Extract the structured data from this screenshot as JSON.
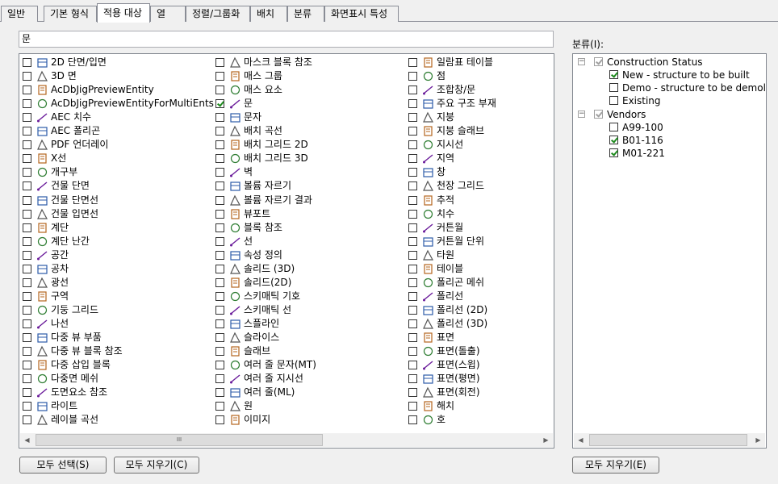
{
  "tabs": [
    "일반",
    "기본 형식",
    "적용 대상",
    "열",
    "정렬/그룹화",
    "배치",
    "분류",
    "화면표시 특성"
  ],
  "search": {
    "value": "문"
  },
  "object_list": {
    "columns": [
      [
        {
          "label": "2D 단면/입면",
          "icon": "section-elevation-icon",
          "checked": false
        },
        {
          "label": "3D 면",
          "icon": "3d-face-icon",
          "checked": false
        },
        {
          "label": "AcDbJigPreviewEntity",
          "icon": "generic-entity-icon",
          "checked": false
        },
        {
          "label": "AcDbJigPreviewEntityForMultiEnts",
          "icon": "generic-entity-icon",
          "checked": false
        },
        {
          "label": "AEC 치수",
          "icon": "aec-dimension-icon",
          "checked": false
        },
        {
          "label": "AEC 폴리곤",
          "icon": "aec-polygon-icon",
          "checked": false
        },
        {
          "label": "PDF 언더레이",
          "icon": "pdf-icon",
          "checked": false
        },
        {
          "label": "X선",
          "icon": "xline-icon",
          "checked": false
        },
        {
          "label": "개구부",
          "icon": "opening-icon",
          "checked": false
        },
        {
          "label": "건물 단면",
          "icon": "building-section-icon",
          "checked": false
        },
        {
          "label": "건물 단면선",
          "icon": "section-line-icon",
          "checked": false
        },
        {
          "label": "건물 입면선",
          "icon": "elevation-line-icon",
          "checked": false
        },
        {
          "label": "계단",
          "icon": "stair-icon",
          "checked": false
        },
        {
          "label": "계단 난간",
          "icon": "railing-icon",
          "checked": false
        },
        {
          "label": "공간",
          "icon": "space-icon",
          "checked": false
        },
        {
          "label": "공차",
          "icon": "tolerance-icon",
          "checked": false
        },
        {
          "label": "광선",
          "icon": "ray-icon",
          "checked": false
        },
        {
          "label": "구역",
          "icon": "zone-icon",
          "checked": false
        },
        {
          "label": "기둥 그리드",
          "icon": "column-grid-icon",
          "checked": false
        },
        {
          "label": "나선",
          "icon": "helix-icon",
          "checked": false
        },
        {
          "label": "다중 뷰 부품",
          "icon": "mvpart-icon",
          "checked": false
        },
        {
          "label": "다중 뷰 블록 참조",
          "icon": "mvblock-icon",
          "checked": false
        },
        {
          "label": "다중 삽입 블록",
          "icon": "minsert-icon",
          "checked": false
        },
        {
          "label": "다중면 메쉬",
          "icon": "polyface-mesh-icon",
          "checked": false
        },
        {
          "label": "도면요소 참조",
          "icon": "detail-ref-icon",
          "checked": false
        },
        {
          "label": "라이트",
          "icon": "light-icon",
          "checked": false
        },
        {
          "label": "레이블 곡선",
          "icon": "label-curve-icon",
          "checked": false
        }
      ],
      [
        {
          "label": "마스크 블록 참조",
          "icon": "mask-block-icon",
          "checked": false
        },
        {
          "label": "매스 그룹",
          "icon": "mass-group-icon",
          "checked": false
        },
        {
          "label": "매스 요소",
          "icon": "mass-element-icon",
          "checked": false
        },
        {
          "label": "문",
          "icon": "door-icon",
          "checked": true
        },
        {
          "label": "문자",
          "icon": "text-icon",
          "checked": false
        },
        {
          "label": "배치 곡선",
          "icon": "layout-curve-icon",
          "checked": false
        },
        {
          "label": "배치 그리드 2D",
          "icon": "layout-grid-2d-icon",
          "checked": false
        },
        {
          "label": "배치 그리드 3D",
          "icon": "layout-grid-3d-icon",
          "checked": false
        },
        {
          "label": "벽",
          "icon": "wall-icon",
          "checked": false
        },
        {
          "label": "볼륨 자르기",
          "icon": "slice-icon",
          "checked": false
        },
        {
          "label": "볼륨 자르기 결과",
          "icon": "slice-result-icon",
          "checked": false
        },
        {
          "label": "뷰포트",
          "icon": "viewport-icon",
          "checked": false
        },
        {
          "label": "블록 참조",
          "icon": "block-ref-icon",
          "checked": false
        },
        {
          "label": "선",
          "icon": "line-icon",
          "checked": false
        },
        {
          "label": "속성 정의",
          "icon": "attdef-icon",
          "checked": false
        },
        {
          "label": "솔리드 (3D)",
          "icon": "solid3d-icon",
          "checked": false
        },
        {
          "label": "솔리드(2D)",
          "icon": "solid2d-icon",
          "checked": false
        },
        {
          "label": "스키매틱 기호",
          "icon": "schematic-symbol-icon",
          "checked": false
        },
        {
          "label": "스키매틱 선",
          "icon": "schematic-line-icon",
          "checked": false
        },
        {
          "label": "스플라인",
          "icon": "spline-icon",
          "checked": false
        },
        {
          "label": "슬라이스",
          "icon": "slice2-icon",
          "checked": false
        },
        {
          "label": "슬래브",
          "icon": "slab-icon",
          "checked": false
        },
        {
          "label": "여러 줄 문자(MT)",
          "icon": "mtext-icon",
          "checked": false
        },
        {
          "label": "여러 줄 지시선",
          "icon": "mleader-icon",
          "checked": false
        },
        {
          "label": "여러 줄(ML)",
          "icon": "mline-icon",
          "checked": false
        },
        {
          "label": "원",
          "icon": "circle-icon",
          "checked": false
        },
        {
          "label": "이미지",
          "icon": "image-icon",
          "checked": false
        }
      ],
      [
        {
          "label": "일람표 테이블",
          "icon": "schedule-table-icon",
          "checked": false
        },
        {
          "label": "점",
          "icon": "point-icon",
          "checked": false
        },
        {
          "label": "조합창/문",
          "icon": "door-window-assembly-icon",
          "checked": false
        },
        {
          "label": "주요 구조 부재",
          "icon": "structural-member-icon",
          "checked": false
        },
        {
          "label": "지붕",
          "icon": "roof-icon",
          "checked": false
        },
        {
          "label": "지붕 슬래브",
          "icon": "roof-slab-icon",
          "checked": false
        },
        {
          "label": "지시선",
          "icon": "leader-icon",
          "checked": false
        },
        {
          "label": "지역",
          "icon": "region-icon",
          "checked": false
        },
        {
          "label": "창",
          "icon": "window-icon",
          "checked": false
        },
        {
          "label": "천장 그리드",
          "icon": "ceiling-grid-icon",
          "checked": false
        },
        {
          "label": "추적",
          "icon": "trace-icon",
          "checked": false
        },
        {
          "label": "치수",
          "icon": "dimension-icon",
          "checked": false
        },
        {
          "label": "커튼월",
          "icon": "curtain-wall-icon",
          "checked": false
        },
        {
          "label": "커튼월 단위",
          "icon": "curtain-wall-unit-icon",
          "checked": false
        },
        {
          "label": "타원",
          "icon": "ellipse-icon",
          "checked": false
        },
        {
          "label": "테이블",
          "icon": "table-icon",
          "checked": false
        },
        {
          "label": "폴리곤 메쉬",
          "icon": "polygon-mesh-icon",
          "checked": false
        },
        {
          "label": "폴리선",
          "icon": "polyline-icon",
          "checked": false
        },
        {
          "label": "폴리선 (2D)",
          "icon": "polyline-2d-icon",
          "checked": false
        },
        {
          "label": "폴리선 (3D)",
          "icon": "polyline-3d-icon",
          "checked": false
        },
        {
          "label": "표면",
          "icon": "surface-icon",
          "checked": false
        },
        {
          "label": "표면(돌출)",
          "icon": "surface-extrude-icon",
          "checked": false
        },
        {
          "label": "표면(스윕)",
          "icon": "surface-sweep-icon",
          "checked": false
        },
        {
          "label": "표면(평면)",
          "icon": "surface-planar-icon",
          "checked": false
        },
        {
          "label": "표면(회전)",
          "icon": "surface-revolve-icon",
          "checked": false
        },
        {
          "label": "해치",
          "icon": "hatch-icon",
          "checked": false
        },
        {
          "label": "호",
          "icon": "arc-icon",
          "checked": false
        }
      ]
    ],
    "scroll_thumb_label": "III"
  },
  "buttons": {
    "select_all": "모두 선택(S)",
    "clear_all": "모두 지우기(C)",
    "clear_categories": "모두 지우기(E)"
  },
  "categories": {
    "label": "분류(I):",
    "tree": [
      {
        "label": "Construction Status",
        "level": 0,
        "checked": true,
        "grey": true,
        "expander": "−",
        "children": [
          {
            "label": "New - structure to be built",
            "checked": true
          },
          {
            "label": "Demo - structure to be demolis",
            "checked": false
          },
          {
            "label": "Existing",
            "checked": false
          }
        ]
      },
      {
        "label": "Vendors",
        "level": 0,
        "checked": true,
        "grey": true,
        "expander": "−",
        "children": [
          {
            "label": "A99-100",
            "checked": false
          },
          {
            "label": "B01-116",
            "checked": true
          },
          {
            "label": "M01-221",
            "checked": true
          }
        ]
      }
    ]
  },
  "colors": {
    "check_green": "#1d8a1d",
    "panel_bg": "#f0f0f0",
    "border": "#828790"
  }
}
